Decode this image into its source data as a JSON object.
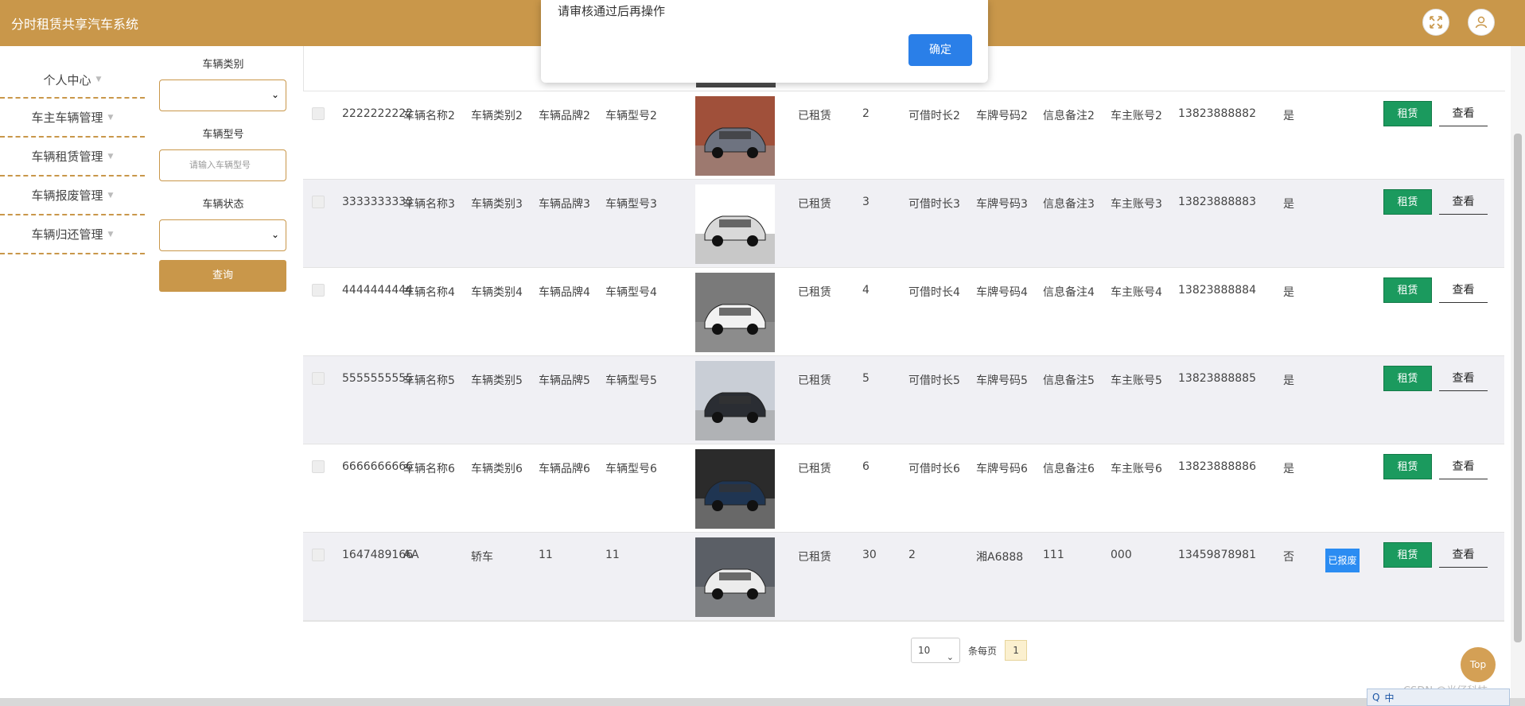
{
  "app": {
    "title": "分时租赁共享汽车系统"
  },
  "header": {
    "fullscreen_icon": "fullscreen-icon",
    "user_icon": "user-icon"
  },
  "sidebar": {
    "items": [
      {
        "label": "个人中心"
      },
      {
        "label": "车主车辆管理"
      },
      {
        "label": "车辆租赁管理"
      },
      {
        "label": "车辆报废管理"
      },
      {
        "label": "车辆归还管理"
      }
    ]
  },
  "filters": {
    "category_label": "车辆类别",
    "model_label": "车辆型号",
    "model_placeholder": "请输入车辆型号",
    "status_label": "车辆状态",
    "query_label": "查询"
  },
  "dialog": {
    "message": "请审核通过后再操作",
    "ok_label": "确定"
  },
  "table": {
    "rent_label": "租赁",
    "view_label": "查看",
    "rows": [
      {
        "id": "2222222222",
        "name": "车辆名称2",
        "category": "车辆类别2",
        "brand": "车辆品牌2",
        "model": "车辆型号2",
        "status": "已租赁",
        "count": "2",
        "duration": "可借时长2",
        "plate": "车牌号码2",
        "note": "信息备注2",
        "owner": "车主账号2",
        "phone": "13823888882",
        "flag": "是",
        "scrap": ""
      },
      {
        "id": "3333333333",
        "name": "车辆名称3",
        "category": "车辆类别3",
        "brand": "车辆品牌3",
        "model": "车辆型号3",
        "status": "已租赁",
        "count": "3",
        "duration": "可借时长3",
        "plate": "车牌号码3",
        "note": "信息备注3",
        "owner": "车主账号3",
        "phone": "13823888883",
        "flag": "是",
        "scrap": ""
      },
      {
        "id": "4444444444",
        "name": "车辆名称4",
        "category": "车辆类别4",
        "brand": "车辆品牌4",
        "model": "车辆型号4",
        "status": "已租赁",
        "count": "4",
        "duration": "可借时长4",
        "plate": "车牌号码4",
        "note": "信息备注4",
        "owner": "车主账号4",
        "phone": "13823888884",
        "flag": "是",
        "scrap": ""
      },
      {
        "id": "5555555555",
        "name": "车辆名称5",
        "category": "车辆类别5",
        "brand": "车辆品牌5",
        "model": "车辆型号5",
        "status": "已租赁",
        "count": "5",
        "duration": "可借时长5",
        "plate": "车牌号码5",
        "note": "信息备注5",
        "owner": "车主账号5",
        "phone": "13823888885",
        "flag": "是",
        "scrap": ""
      },
      {
        "id": "6666666666",
        "name": "车辆名称6",
        "category": "车辆类别6",
        "brand": "车辆品牌6",
        "model": "车辆型号6",
        "status": "已租赁",
        "count": "6",
        "duration": "可借时长6",
        "plate": "车牌号码6",
        "note": "信息备注6",
        "owner": "车主账号6",
        "phone": "13823888886",
        "flag": "是",
        "scrap": ""
      },
      {
        "id": "1647489166",
        "name": "AA",
        "category": "轿车",
        "brand": "11",
        "model": "11",
        "status": "已租赁",
        "count": "30",
        "duration": "2",
        "plate": "湘A6888",
        "note": "111",
        "owner": "000",
        "phone": "13459878981",
        "flag": "否",
        "scrap": "已报废"
      }
    ]
  },
  "pager": {
    "page_size": "10",
    "per_page_label": "条每页",
    "current_page": "1"
  },
  "back_to_top": "Top",
  "watermark": "CSDN @光仔科技",
  "tray": {
    "q": "Q",
    "lang": "中"
  },
  "colors": {
    "header": "#c9974a",
    "rent_button": "#1b9a5e",
    "ok_button": "#2a7fe8",
    "scrap_badge": "#2b8cf2"
  }
}
